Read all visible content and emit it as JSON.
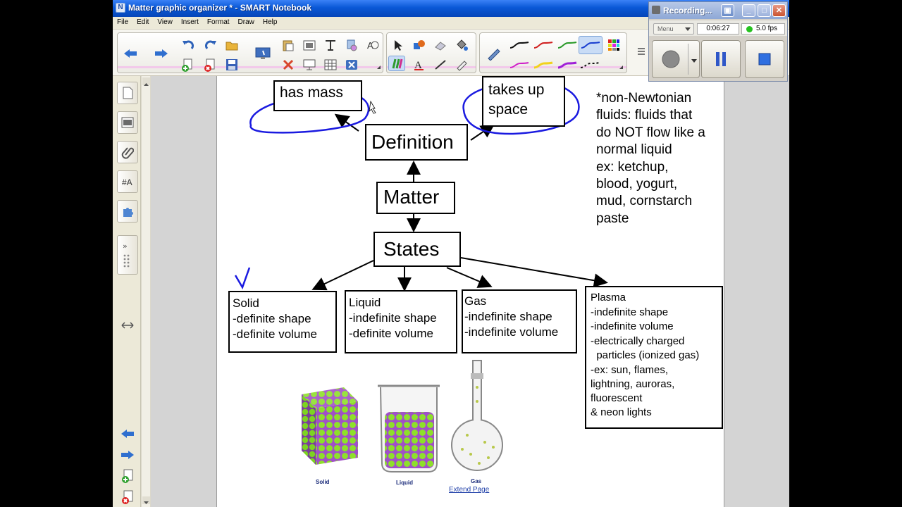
{
  "window": {
    "title": "Matter graphic organizer * - SMART Notebook"
  },
  "menu": {
    "items": [
      "File",
      "Edit",
      "View",
      "Insert",
      "Format",
      "Draw",
      "Help"
    ]
  },
  "recorder": {
    "title": "Recording...",
    "menu_label": "Menu",
    "elapsed": "0:06:27",
    "fps": "5.0 fps",
    "status_color": "#25c21f"
  },
  "page": {
    "nodes": {
      "matter": "Matter",
      "definition": "Definition",
      "states": "States",
      "has_mass": "has mass",
      "takes_up_space_line1": "takes up",
      "takes_up_space_line2": "space"
    },
    "note_lines": [
      "*non-Newtonian",
      "fluids: fluids that",
      "do NOT flow like a",
      "normal liquid",
      "ex: ketchup,",
      "blood, yogurt,",
      "mud, cornstarch",
      "paste"
    ],
    "solid_lines": [
      "Solid",
      "-definite shape",
      "-definite volume"
    ],
    "liquid_lines": [
      "Liquid",
      "-indefinite shape",
      "-definite volume"
    ],
    "gas_lines": [
      "Gas",
      "-indefinite shape",
      "-indefinite volume"
    ],
    "plasma_lines": [
      "Plasma",
      "-indefinite shape",
      "-indefinite volume",
      "-electrically charged",
      "  particles (ionized gas)",
      "-ex: sun, flames,",
      "lightning, auroras,",
      "fluorescent",
      "& neon lights"
    ],
    "image_captions": {
      "solid": "Solid",
      "liquid": "Liquid",
      "gas": "Gas"
    },
    "extend_page": "Extend Page"
  },
  "colors": {
    "ink_blue": "#1a1ae0",
    "particle_green": "#7dd321",
    "particle_purple": "#a050c8"
  }
}
